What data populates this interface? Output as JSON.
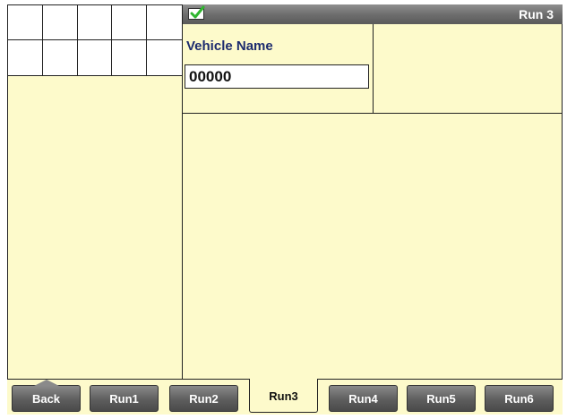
{
  "header": {
    "title": "Run 3",
    "status_icon": "check-icon"
  },
  "form": {
    "label": "Vehicle Name",
    "value": "00000"
  },
  "tabs": [
    {
      "label": "Back",
      "active": false
    },
    {
      "label": "Run1",
      "active": false
    },
    {
      "label": "Run2",
      "active": false
    },
    {
      "label": "Run3",
      "active": true
    },
    {
      "label": "Run4",
      "active": false
    },
    {
      "label": "Run5",
      "active": false
    },
    {
      "label": "Run6",
      "active": false
    }
  ],
  "colors": {
    "background": "#fdfacb",
    "bar": "#6e6e6e",
    "label": "#1c2b6e",
    "check": "#2fb52f"
  }
}
